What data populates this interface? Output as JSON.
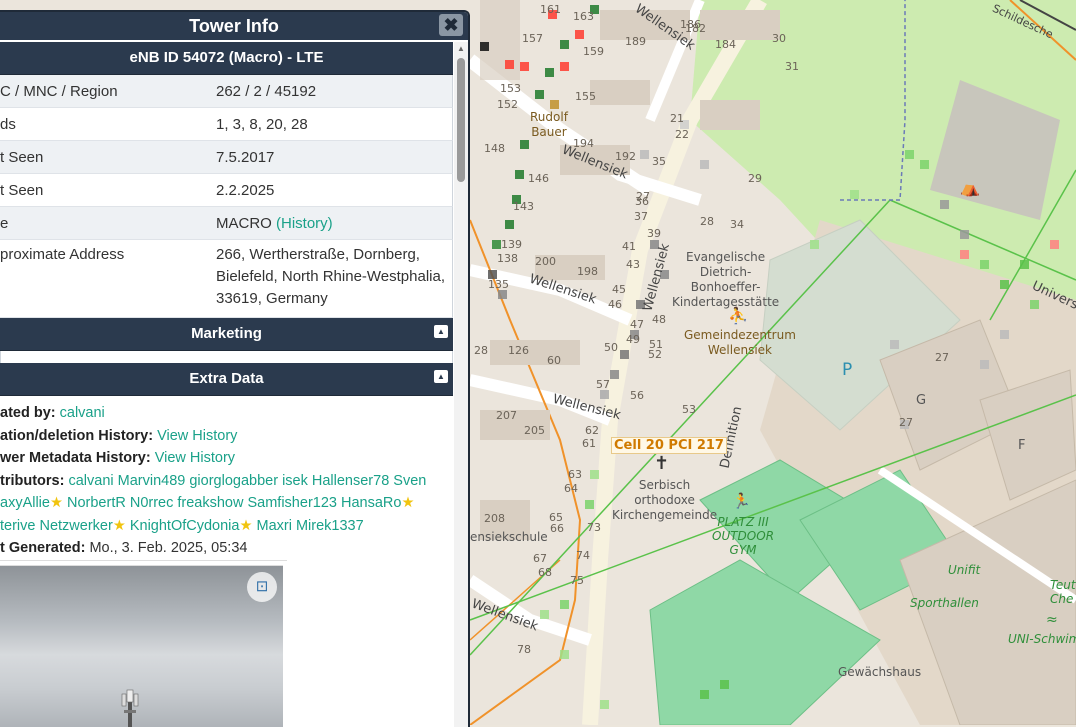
{
  "panel": {
    "title": "Tower Info",
    "close_label": "✖",
    "subtitle": "eNB ID 54072 (Macro) - LTE",
    "rows": [
      {
        "label": "C / MNC / Region",
        "value": "262 / 2 / 45192"
      },
      {
        "label": "ds",
        "value": "1, 3, 8, 20, 28"
      },
      {
        "label": "t Seen",
        "value": "7.5.2017"
      },
      {
        "label": "t Seen",
        "value": "2.2.2025"
      },
      {
        "label": "e",
        "value": "MACRO",
        "link": "(History)"
      },
      {
        "label": "proximate Address",
        "value": "266, Wertherstraße, Dornberg, Bielefeld, North Rhine-Westphalia, 33619, Germany"
      }
    ],
    "marketing_title": "Marketing",
    "extra_title": "Extra Data",
    "extra": {
      "created_by_label": "ated by:",
      "created_by_value": "calvani",
      "loc_history_label": "ation/deletion History:",
      "loc_history_link": "View History",
      "meta_history_label": "wer Metadata History:",
      "meta_history_link": "View History",
      "contributors_label": "tributors:",
      "contributors_line1": "calvani Marvin489 giorglogabber isek Hallenser78 Sven",
      "contributors_line2a": "axyAllie",
      "contributors_line2b": " NorbertR N0rrec freakshow Samfisher123 HansaRo",
      "contributors_line3a": "terive Netzwerker",
      "contributors_line3b": " KnightOfCydonia",
      "contributors_line3c": " Maxri Mirek1337",
      "generated_label": "t Generated:",
      "generated_value": "Mo., 3. Feb. 2025, 05:34",
      "star_glyph": "★"
    },
    "photo_button_icon": "⊡"
  },
  "map": {
    "cell_label": "Cell 20 PCI 217",
    "streets": [
      "Wellensiek",
      "Wellensiek",
      "Wellensiek",
      "Wellensiek",
      "Wellensiek",
      "Wellensiek",
      "Wellensiek",
      "Wellensiek",
      "Wellensiek",
      "Definition",
      "Universit",
      "Schildesche"
    ],
    "pois": {
      "rudolf": "Rudolf\nBauer",
      "kita": "Evangelische\nDietrich-\nBonhoeffer-\nKindertagesstätte",
      "gemeinde": "Gemeindezentrum\nWellensiek",
      "church": "Serbisch\northodoxe\nKirchengemeinde",
      "platz": "PLATZ III\nOUTDOOR\nGYM",
      "unifit": "Unifit",
      "sporthallen": "Sporthallen",
      "schwimm": "UNI-Schwimm",
      "gewachshaus": "Gewächshaus",
      "teuto": "Teuto\nChe",
      "schule": "ensiekschule",
      "parking": "P",
      "g": "G",
      "f": "F"
    },
    "house_numbers": [
      "161",
      "163",
      "157",
      "159",
      "153",
      "155",
      "152",
      "189",
      "186",
      "148",
      "194",
      "192",
      "146",
      "143",
      "139",
      "138",
      "200",
      "198",
      "41",
      "43",
      "135",
      "45",
      "46",
      "48",
      "47",
      "50",
      "49",
      "51",
      "52",
      "57",
      "56",
      "53",
      "126",
      "28",
      "60",
      "207",
      "205",
      "62",
      "61",
      "63",
      "64",
      "65",
      "66",
      "67",
      "68",
      "73",
      "74",
      "75",
      "78",
      "208",
      "21",
      "22",
      "35",
      "29",
      "30",
      "31",
      "27",
      "28",
      "34",
      "37",
      "39",
      "36",
      "27",
      "27",
      "182",
      "184"
    ]
  }
}
